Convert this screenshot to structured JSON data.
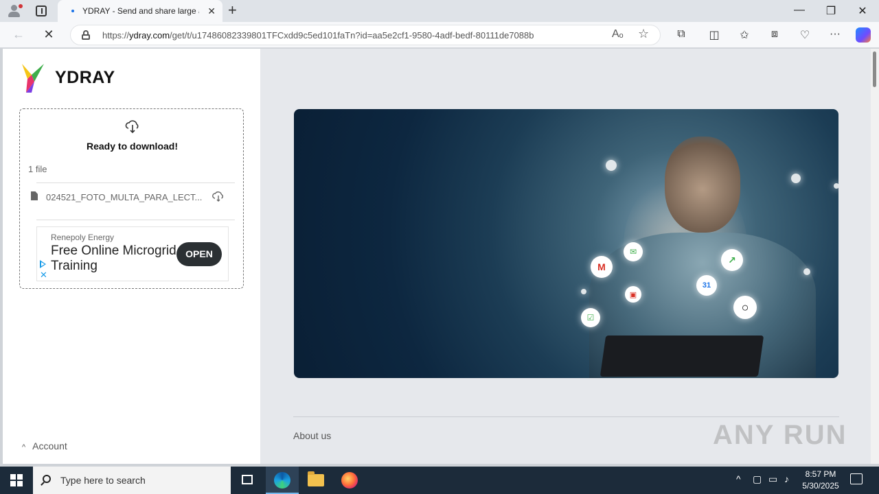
{
  "browser": {
    "tab_title": "YDRAY - Send and share large an",
    "tab_close": "✕",
    "new_tab": "+",
    "url_protocol": "https://",
    "url_host": "ydray.com",
    "url_path": "/get/t/u17486082339801TFCxdd9c5ed101faTn?id=aa5e2cf1-9580-4adf-bedf-80111de7088b",
    "window_minimize": "—",
    "window_restore": "❐",
    "window_close": "✕",
    "read_aloud": "Aₒ",
    "favorite": "☆",
    "more": "···"
  },
  "sidebar": {
    "brand": "YDRAY",
    "ready_text": "Ready to download!",
    "file_count": "1 file",
    "file_name": "024521_FOTO_MULTA_PARA_LECT...",
    "account_label": "Account",
    "account_chevron": "^"
  },
  "ad": {
    "advertiser": "Renepoly Energy",
    "headline": "Free Online Microgrid Training",
    "cta": "OPEN",
    "close": "✕"
  },
  "footer": {
    "about": "About us"
  },
  "watermark": "ANY RUN",
  "taskbar": {
    "search_placeholder": "Type here to search",
    "time": "8:57 PM",
    "date": "5/30/2025"
  },
  "colors": {
    "logo_top": "#f5c518",
    "logo_left": "#e8336b",
    "logo_right": "#3fae4b",
    "ad_cta_bg": "#2b3033",
    "taskbar_bg": "#1c2b3a"
  }
}
